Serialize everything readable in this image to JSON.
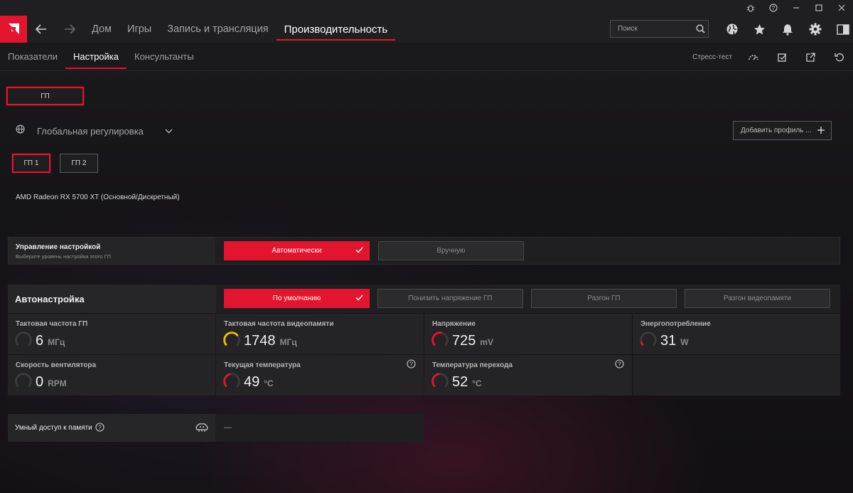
{
  "titlebar": {
    "icons": [
      "bug-icon",
      "help-icon",
      "minimize-icon",
      "maximize-icon",
      "close-icon"
    ]
  },
  "nav": {
    "tabs": [
      {
        "label": "Дом",
        "active": false
      },
      {
        "label": "Игры",
        "active": false
      },
      {
        "label": "Запись и трансляция",
        "active": false
      },
      {
        "label": "Производительность",
        "active": true
      }
    ],
    "search_placeholder": "Поиск",
    "icons": [
      "globe-icon",
      "star-icon",
      "bell-icon",
      "gear-icon",
      "sidebar-icon"
    ]
  },
  "subnav": {
    "tabs": [
      {
        "label": "Показатели",
        "active": false
      },
      {
        "label": "Настройка",
        "active": true
      },
      {
        "label": "Консультанты",
        "active": false
      }
    ],
    "stress_test": "Стресс-тест",
    "icons": [
      "speedometer-icon",
      "check-box-icon",
      "export-icon",
      "reset-icon"
    ]
  },
  "gpu_filter": "ГП",
  "profile": {
    "label": "Глобальная регулировка",
    "add_profile": "Добавить профиль ..."
  },
  "gpus": [
    {
      "label": "ГП 1",
      "selected": true
    },
    {
      "label": "ГП 2",
      "selected": false
    }
  ],
  "gpu_name": "AMD Radeon RX 5700 XT (Основной/Дискретный)",
  "tuning_control": {
    "title": "Управление настройкой",
    "subtitle": "Выберите уровень настройки этого ГП",
    "options": [
      {
        "label": "Автоматически",
        "selected": true
      },
      {
        "label": "Вручную",
        "selected": false
      }
    ]
  },
  "auto_tuning": {
    "title": "Автонастройка",
    "options": [
      {
        "label": "По умолчанию",
        "selected": true
      },
      {
        "label": "Понизить напряжение ГП",
        "selected": false
      },
      {
        "label": "Разгон ГП",
        "selected": false
      },
      {
        "label": "Разгон видеопамяти",
        "selected": false
      }
    ]
  },
  "metrics": [
    {
      "title": "Тактовая частота ГП",
      "value": "6",
      "unit": "МГц",
      "color": "#3a3a3c",
      "fill": 0.0,
      "help": false
    },
    {
      "title": "Тактовая частота видеопамяти",
      "value": "1748",
      "unit": "МГц",
      "color": "#f2c200",
      "fill": 0.7,
      "help": false
    },
    {
      "title": "Напряжение",
      "value": "725",
      "unit": "mV",
      "color": "#e3152e",
      "fill": 0.55,
      "help": false
    },
    {
      "title": "Энергопотребление",
      "value": "31",
      "unit": "W",
      "color": "#e3152e",
      "fill": 0.12,
      "help": false
    },
    {
      "title": "Скорость вентилятора",
      "value": "0",
      "unit": "RPM",
      "color": "#3a3a3c",
      "fill": 0.0,
      "help": false
    },
    {
      "title": "Текущая температура",
      "value": "49",
      "unit": "°C",
      "color": "#e3152e",
      "fill": 0.45,
      "help": true
    },
    {
      "title": "Температура перехода",
      "value": "52",
      "unit": "°C",
      "color": "#e3152e",
      "fill": 0.48,
      "help": true
    }
  ],
  "smart_access": {
    "label": "Умный доступ к памяти",
    "value": "—"
  }
}
